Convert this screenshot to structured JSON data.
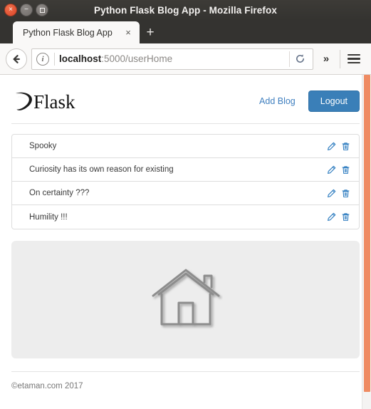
{
  "window": {
    "title": "Python Flask Blog App - Mozilla Firefox",
    "controls": {
      "close_label": "×",
      "minimize_label": "−",
      "maximize_label": ""
    }
  },
  "browser": {
    "tab": {
      "label": "Python Flask Blog App",
      "close_label": "×"
    },
    "new_tab_label": "+",
    "toolbar": {
      "back_icon": "back-arrow-icon",
      "info_icon": "page-info-icon",
      "info_label": "i",
      "url_host": "localhost",
      "url_rest": ":5000/userHome",
      "url_full": "localhost:5000/userHome",
      "reload_icon": "reload-icon",
      "overflow_label": "»",
      "menu_icon": "hamburger-menu-icon"
    }
  },
  "page": {
    "brand": {
      "name": "Flask",
      "logo_icon": "flask-horn-logo-icon"
    },
    "nav": {
      "add_blog_label": "Add Blog",
      "logout_label": "Logout"
    },
    "blogs": [
      {
        "title": "Spooky",
        "edit_icon": "pencil-edit-icon",
        "delete_icon": "trash-delete-icon"
      },
      {
        "title": "Curiosity has its own reason for existing",
        "edit_icon": "pencil-edit-icon",
        "delete_icon": "trash-delete-icon"
      },
      {
        "title": "On certainty ???",
        "edit_icon": "pencil-edit-icon",
        "delete_icon": "trash-delete-icon"
      },
      {
        "title": "Humility !!!",
        "edit_icon": "pencil-edit-icon",
        "delete_icon": "trash-delete-icon"
      }
    ],
    "hero": {
      "image_icon": "house-outline-icon"
    },
    "footer": {
      "copyright": "©etaman.com 2017"
    }
  },
  "colors": {
    "titlebar_bg": "#343330",
    "close_button": "#e05a33",
    "primary_button": "#3a7fb8",
    "link": "#3f7fbf",
    "icon_blue": "#2f7dc0",
    "scrollbar_thumb": "#ef8b62",
    "panel_bg": "#ededed"
  }
}
